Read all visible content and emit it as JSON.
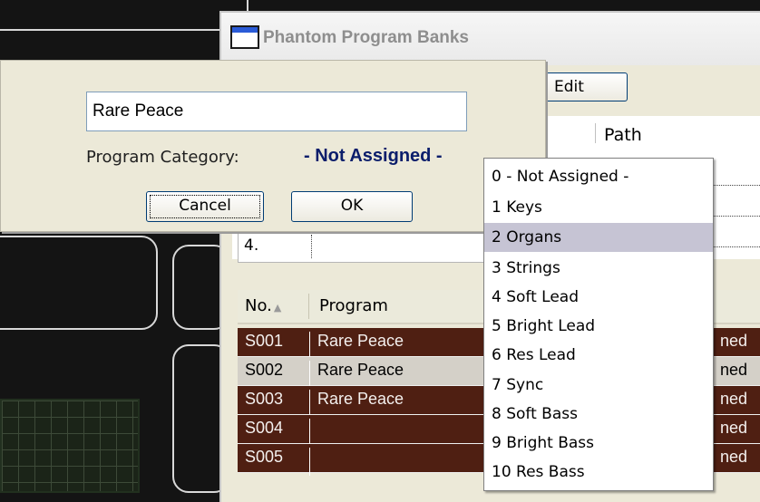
{
  "window": {
    "title": "Phantom Program Banks"
  },
  "toolbar": {
    "edit_label": "Edit"
  },
  "list": {
    "path_header": "Path",
    "row4_label": "4."
  },
  "table": {
    "headers": {
      "no": "No.",
      "program": "Program"
    },
    "sort_icon": "sort-ascending-icon",
    "rows": [
      {
        "no": "S001",
        "program": "Rare Peace",
        "category": "ned"
      },
      {
        "no": "S002",
        "program": "Rare Peace",
        "category": "ned"
      },
      {
        "no": "S003",
        "program": "Rare Peace",
        "category": "ned"
      },
      {
        "no": "S004",
        "program": "",
        "category": "ned"
      },
      {
        "no": "S005",
        "program": "",
        "category": "ned"
      }
    ]
  },
  "dialog": {
    "name_value": "Rare Peace",
    "category_label": "Program Category:",
    "category_value": "- Not Assigned -",
    "cancel_label": "Cancel",
    "ok_label": "OK"
  },
  "dropdown": {
    "selected_index": 2,
    "items": [
      "0 - Not Assigned -",
      "1 Keys",
      "2 Organs",
      "3 Strings",
      "4 Soft Lead",
      "5 Bright Lead",
      "6 Res Lead",
      "7 Sync",
      "8 Soft Bass",
      "9 Bright Bass",
      "10 Res Bass"
    ]
  },
  "colors": {
    "accent": "#0a1d6b",
    "row_dark": "#4f1f12",
    "row_light": "#d4d0c8",
    "selection": "#c6c4d4"
  }
}
